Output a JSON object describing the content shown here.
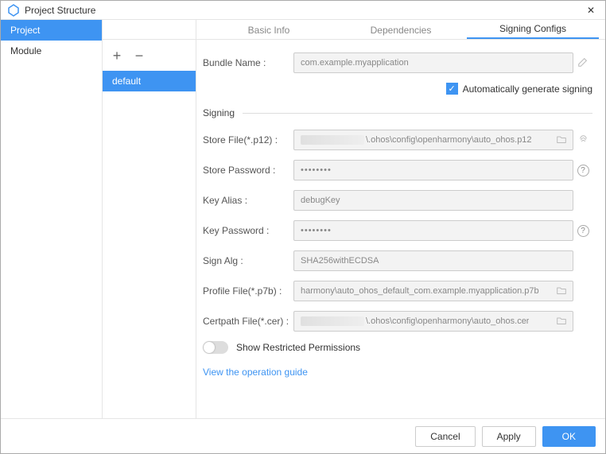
{
  "title": "Project Structure",
  "sidebar": {
    "items": [
      "Project",
      "Module"
    ],
    "selected": 0
  },
  "center": {
    "items": [
      "default"
    ],
    "selected": 0
  },
  "tabs": {
    "items": [
      "Basic Info",
      "Dependencies",
      "Signing Configs"
    ],
    "active": 2
  },
  "form": {
    "bundleName": {
      "label": "Bundle Name :",
      "value": "com.example.myapplication"
    },
    "autoSigning": {
      "label": "Automatically generate signing",
      "checked": true
    },
    "sectionSigning": "Signing",
    "storeFile": {
      "label": "Store File(*.p12) :",
      "value": "\\.ohos\\config\\openharmony\\auto_ohos.p12"
    },
    "storePassword": {
      "label": "Store Password :",
      "value": "••••••••"
    },
    "keyAlias": {
      "label": "Key Alias :",
      "value": "debugKey"
    },
    "keyPassword": {
      "label": "Key Password :",
      "value": "••••••••"
    },
    "signAlg": {
      "label": "Sign Alg :",
      "value": "SHA256withECDSA"
    },
    "profileFile": {
      "label": "Profile File(*.p7b) :",
      "value": "harmony\\auto_ohos_default_com.example.myapplication.p7b"
    },
    "certpathFile": {
      "label": "Certpath File(*.cer) :",
      "value": "\\.ohos\\config\\openharmony\\auto_ohos.cer"
    },
    "showRestricted": "Show Restricted Permissions",
    "guideLink": "View the operation guide"
  },
  "footer": {
    "cancel": "Cancel",
    "apply": "Apply",
    "ok": "OK"
  }
}
